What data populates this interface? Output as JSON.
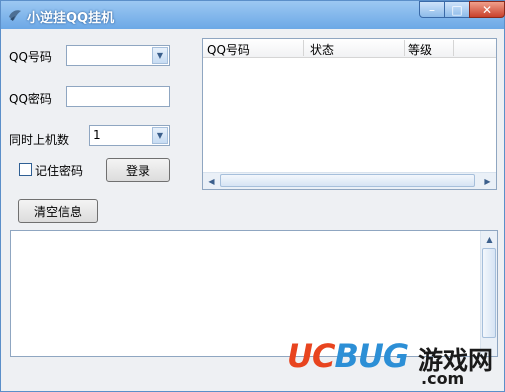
{
  "window": {
    "title": "小逆挂QQ挂机",
    "controls": {
      "minimize": "–",
      "maximize": "□",
      "close": "✕"
    }
  },
  "form": {
    "qq_label": "QQ号码",
    "qq_value": "",
    "password_label": "QQ密码",
    "password_value": "",
    "simultaneous_label": "同时上机数",
    "simultaneous_value": "1",
    "remember_label": "记住密码",
    "remember_checked": false,
    "login_button": "登录",
    "clear_button": "清空信息"
  },
  "account_list": {
    "columns": [
      "QQ号码",
      "状态",
      "等级"
    ],
    "rows": []
  },
  "log": {
    "text": ""
  },
  "icons": {
    "combo_arrow": "chevron-down-icon",
    "scroll_left": "arrow-left-icon",
    "scroll_right": "arrow-right-icon",
    "scroll_up": "arrow-up-icon",
    "app_icon": "app-icon"
  },
  "watermark": {
    "brand_uc": "UC",
    "brand_bug": "BUG",
    "cn_text": "游戏网",
    "domain": ".com"
  },
  "colors": {
    "titlebar": "#6ca8e6",
    "close_button": "#c9402a",
    "watermark_uc": "#e8441f",
    "watermark_bug": "#2c8fd6"
  }
}
